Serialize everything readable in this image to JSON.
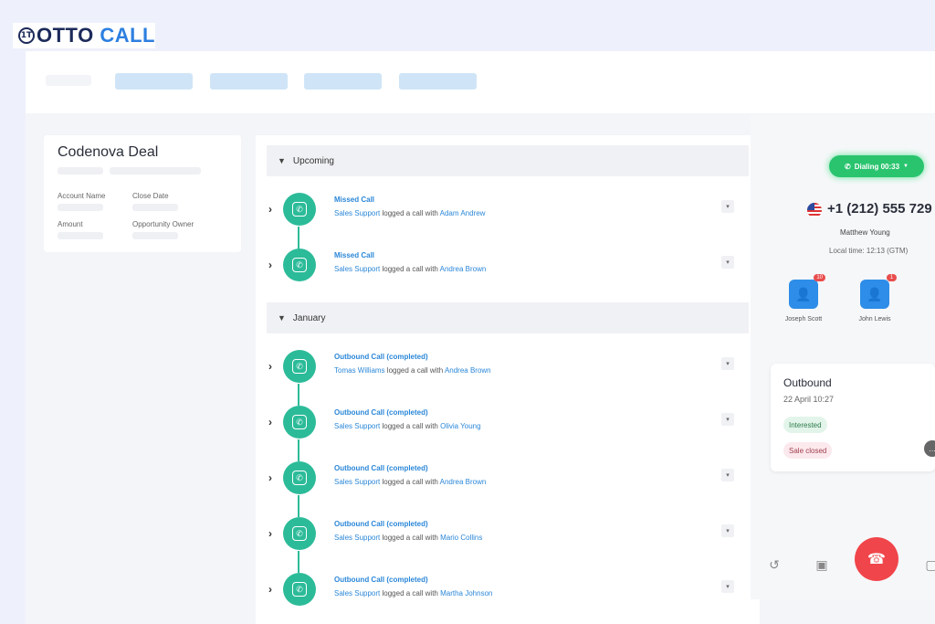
{
  "brand": {
    "mark": "1T",
    "name_part1": "OTTO",
    "name_part2": " CALL"
  },
  "deal": {
    "title": "Codenova Deal",
    "fields": {
      "account_name": "Account Name",
      "close_date": "Close Date",
      "amount": "Amount",
      "opportunity_owner": "Opportunity Owner"
    }
  },
  "timeline": {
    "sections": [
      {
        "title": "Upcoming",
        "rows": [
          {
            "type": "Missed Call",
            "actor": "Sales Support",
            "verb": " logged a call with ",
            "contact": "Adam Andrew"
          },
          {
            "type": "Missed Call",
            "actor": "Sales Support",
            "verb": " logged a call with ",
            "contact": "Andrea Brown"
          }
        ]
      },
      {
        "title": "January",
        "rows": [
          {
            "type": "Outbound Call (completed)",
            "actor": "Tomas Williams",
            "verb": " logged a call with ",
            "contact": "Andrea Brown"
          },
          {
            "type": "Outbound Call (completed)",
            "actor": "Sales Support",
            "verb": " logged a call with ",
            "contact": "Olivia Young"
          },
          {
            "type": "Outbound Call (completed)",
            "actor": "Sales Support",
            "verb": " logged a call with ",
            "contact": "Andrea Brown"
          },
          {
            "type": "Outbound Call (completed)",
            "actor": "Sales Support",
            "verb": " logged a call with ",
            "contact": "Mario Collins"
          },
          {
            "type": "Outbound Call (completed)",
            "actor": "Sales Support",
            "verb": " logged a call with ",
            "contact": "Martha Johnson"
          }
        ]
      }
    ]
  },
  "dialer": {
    "status": "Dialing 00:33",
    "phone": "+1 (212) 555 729",
    "contact": "Matthew Young",
    "local_time": "Local time: 12:13 (GTM)",
    "agents": [
      {
        "name": "Joseph Scott",
        "badge": "10"
      },
      {
        "name": "John Lewis",
        "badge": "1"
      }
    ],
    "card": {
      "title": "Outbound",
      "date": "22 April 10:27",
      "tags": [
        "Interested",
        "Sale closed"
      ]
    }
  },
  "colors": {
    "accent": "#2cbb99",
    "link": "#2b87d8",
    "dial_green": "#2ac46f",
    "hangup": "#f0454a"
  }
}
